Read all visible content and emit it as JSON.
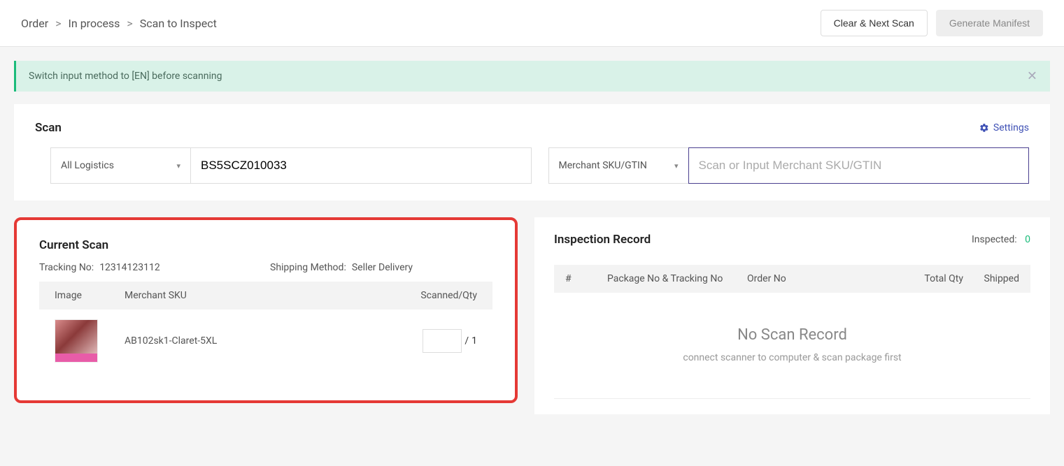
{
  "breadcrumb": {
    "a": "Order",
    "b": "In process",
    "c": "Scan to Inspect"
  },
  "buttons": {
    "clear_next": "Clear & Next Scan",
    "manifest": "Generate Manifest"
  },
  "alert": {
    "text": "Switch input method to [EN] before scanning"
  },
  "scan": {
    "title": "Scan",
    "settings": "Settings",
    "logistics_selected": "All Logistics",
    "tracking_value": "BS5SCZ010033",
    "sku_mode_selected": "Merchant SKU/GTIN",
    "sku_placeholder": "Scan or Input Merchant SKU/GTIN"
  },
  "current": {
    "title": "Current Scan",
    "tracking_label": "Tracking No:",
    "tracking_value": "12314123112",
    "shipping_label": "Shipping Method:",
    "shipping_value": "Seller Delivery",
    "cols": {
      "image": "Image",
      "sku": "Merchant SKU",
      "qty": "Scanned/Qty"
    },
    "rows": [
      {
        "sku": "AB102sk1-Claret-5XL",
        "scanned": "",
        "qty": "1"
      }
    ]
  },
  "inspection": {
    "title": "Inspection Record",
    "inspected_label": "Inspected:",
    "inspected_value": "0",
    "cols": {
      "n": "#",
      "pkg": "Package No & Tracking No",
      "ord": "Order No",
      "tq": "Total Qty",
      "sh": "Shipped"
    },
    "empty_title": "No Scan Record",
    "empty_sub": "connect scanner to computer & scan package first"
  }
}
